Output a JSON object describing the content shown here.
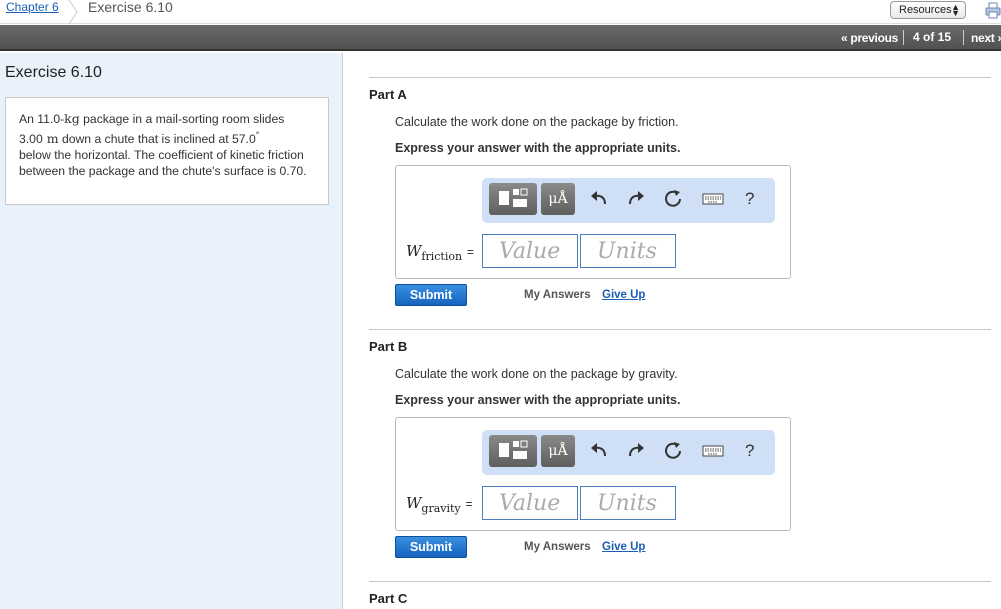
{
  "breadcrumb": {
    "chapter": "Chapter 6",
    "current": "Exercise 6.10"
  },
  "resources": {
    "label": "Resources"
  },
  "nav": {
    "previous": "« previous",
    "count": "4 of 15",
    "next": "next »"
  },
  "left": {
    "title": "Exercise 6.10",
    "problem": {
      "p1": "An 11.0-",
      "kg": "kg",
      "p2": " package in a mail-sorting room slides",
      "num": "3.00",
      "m": " m",
      "p3": " down a chute that is inclined at 57.0",
      "deg": "°",
      "p4": "below the horizontal. The coefficient of kinetic friction between the package and the chute's surface is 0.70."
    }
  },
  "toolbar": {
    "mu_label": "μÅ",
    "help": "?"
  },
  "parts": [
    {
      "title": "Part A",
      "question": "Calculate the work done on the package by friction.",
      "instruction": "Express your answer with the appropriate units.",
      "var": "W",
      "sub": "friction",
      "eq": "=",
      "value_placeholder": "Value",
      "units_placeholder": "Units",
      "submit": "Submit",
      "my_answers": "My Answers",
      "give_up": "Give Up"
    },
    {
      "title": "Part B",
      "question": "Calculate the work done on the package by gravity.",
      "instruction": "Express your answer with the appropriate units.",
      "var": "W",
      "sub": "gravity",
      "eq": "=",
      "value_placeholder": "Value",
      "units_placeholder": "Units",
      "submit": "Submit",
      "my_answers": "My Answers",
      "give_up": "Give Up"
    },
    {
      "title": "Part C"
    }
  ],
  "colors": {
    "accent": "#1565c0",
    "link": "#1a5fb4",
    "panel_bg": "#e9f1fb",
    "navbar": "#5e5e5e"
  }
}
